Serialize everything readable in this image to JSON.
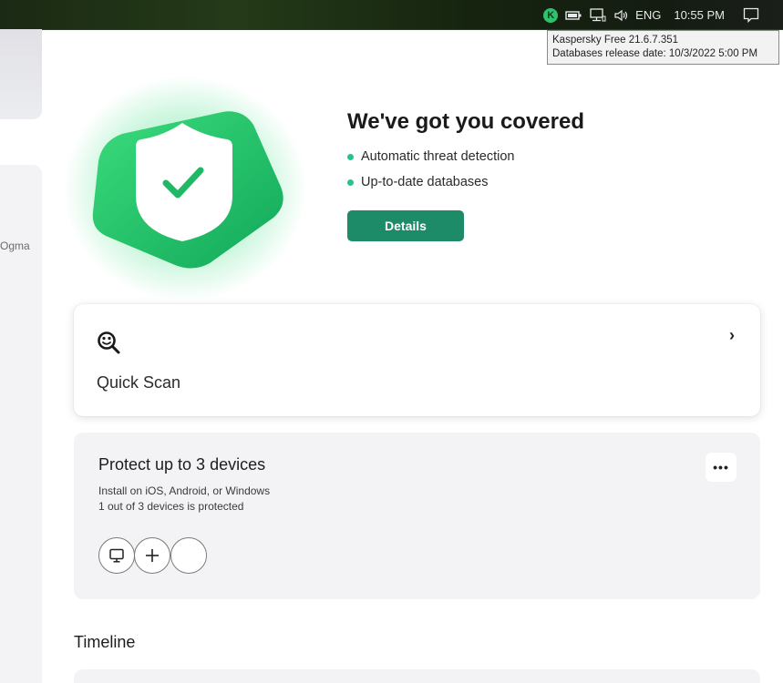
{
  "taskbar": {
    "tray_app_letter": "K",
    "language": "ENG",
    "time": "10:55 PM",
    "icons": [
      "kaspersky-icon",
      "battery-icon",
      "network-icon",
      "volume-icon",
      "notification-icon"
    ]
  },
  "tooltip": {
    "line1": "Kaspersky Free 21.6.7.351",
    "line2": "Databases release date: 10/3/2022 5:00 PM"
  },
  "sidebar": {
    "partial_text": "Ogma"
  },
  "hero": {
    "title": "We've got you covered",
    "bullets": [
      "Automatic threat detection",
      "Up-to-date databases"
    ],
    "details_label": "Details",
    "accent_color": "#1d8a68",
    "bullet_color": "#27c28f"
  },
  "quick_scan": {
    "label": "Quick Scan",
    "icon": "scan-search-icon"
  },
  "devices": {
    "title": "Protect up to 3 devices",
    "line1": "Install on iOS, Android, or Windows",
    "line2": "1 out of 3 devices is protected",
    "protected_count": 1,
    "total_devices": 3,
    "slots": [
      "computer-icon",
      "add-icon",
      "empty"
    ]
  },
  "timeline": {
    "title": "Timeline"
  }
}
